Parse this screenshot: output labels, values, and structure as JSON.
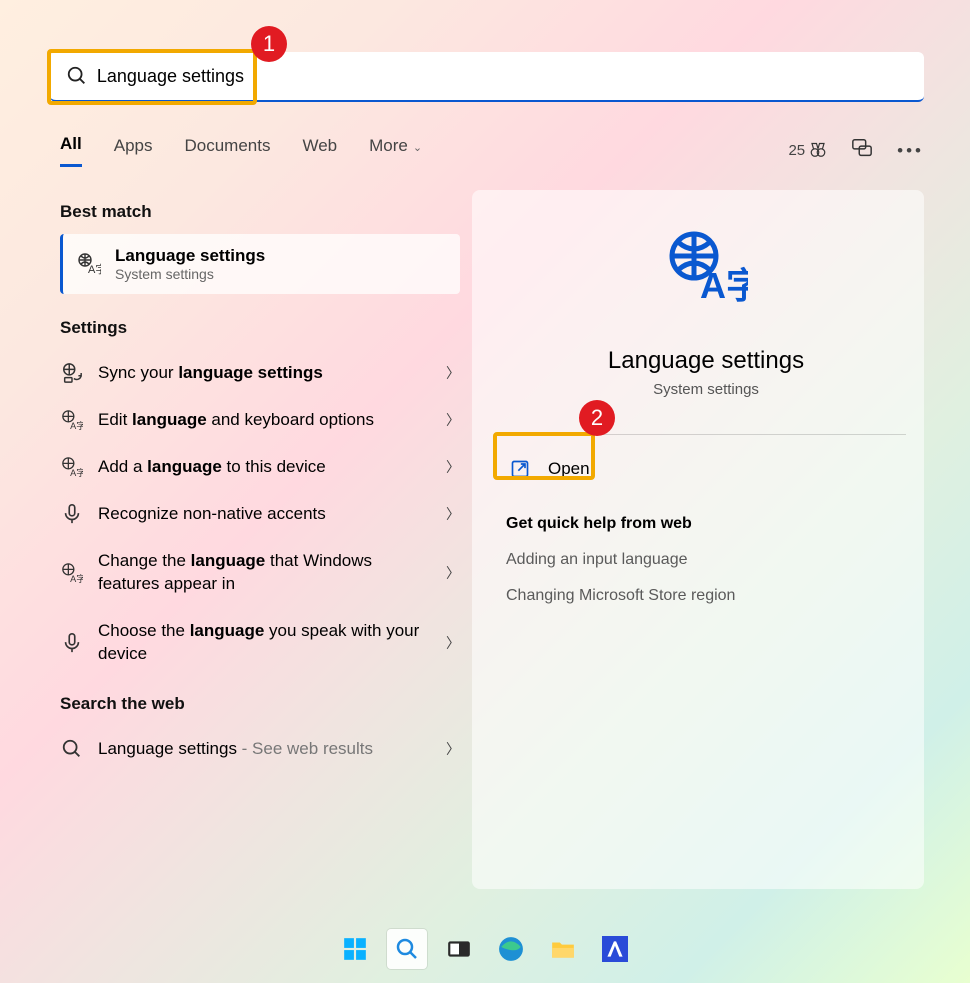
{
  "search": {
    "value": "Language settings"
  },
  "annotations": {
    "badge1": "1",
    "badge2": "2"
  },
  "tabs": {
    "items": [
      "All",
      "Apps",
      "Documents",
      "Web",
      "More"
    ],
    "active": 0,
    "points": "25"
  },
  "best_match": {
    "heading": "Best match",
    "title": "Language settings",
    "subtitle": "System settings"
  },
  "settings": {
    "heading": "Settings",
    "items": [
      {
        "icon": "sync",
        "pre": "Sync your ",
        "bold": "language settings",
        "post": ""
      },
      {
        "icon": "globe-lang",
        "pre": "Edit ",
        "bold": "language",
        "post": " and keyboard options"
      },
      {
        "icon": "globe-lang",
        "pre": "Add a ",
        "bold": "language",
        "post": " to this device"
      },
      {
        "icon": "mic",
        "pre": "Recognize non-native accents",
        "bold": "",
        "post": ""
      },
      {
        "icon": "globe-lang",
        "pre": "Change the ",
        "bold": "language",
        "post": " that Windows features appear in"
      },
      {
        "icon": "mic",
        "pre": "Choose the ",
        "bold": "language",
        "post": " you speak with your device"
      }
    ]
  },
  "search_web": {
    "heading": "Search the web",
    "item": {
      "query": "Language settings",
      "suffix": " - See web results"
    }
  },
  "preview": {
    "title": "Language settings",
    "subtitle": "System settings",
    "open_label": "Open",
    "quick_help": "Get quick help from web",
    "links": [
      "Adding an input language",
      "Changing Microsoft Store region"
    ]
  },
  "taskbar": [
    "start",
    "search",
    "taskview",
    "edge",
    "explorer",
    "app"
  ]
}
